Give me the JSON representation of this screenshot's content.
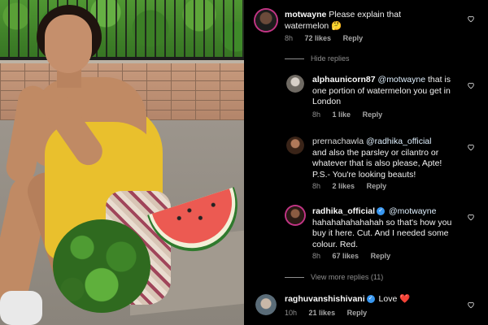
{
  "comments": [
    {
      "username": "motwayne",
      "text_lines": [
        "Please explain that",
        "watermelon 🤔"
      ],
      "time": "8h",
      "likes": "72 likes",
      "reply": "Reply"
    },
    {
      "username": "alphaunicorn87",
      "mention": "@motwayne",
      "text_lines": [
        "that is",
        "one portion of watermelon you get in",
        "London"
      ],
      "time": "8h",
      "likes": "1 like",
      "reply": "Reply"
    },
    {
      "username": "prernachawla",
      "mention": "@radhika_official",
      "text_lines": [
        "and also the parsley or cilantro or",
        "whatever that is also please, Apte!",
        "P.S.- You're looking beauts!"
      ],
      "time": "8h",
      "likes": "2 likes",
      "reply": "Reply"
    },
    {
      "username": "radhika_official",
      "mention": "@motwayne",
      "text_lines": [
        "hahahahahahahah so that's how you",
        "buy it here. Cut. And I needed some",
        "colour. Red."
      ],
      "time": "8h",
      "likes": "67 likes",
      "reply": "Reply"
    },
    {
      "username": "raghuvanshishivani",
      "text": "Love",
      "heart": "❤️",
      "time": "10h",
      "likes": "21 likes",
      "reply": "Reply"
    }
  ],
  "hide_replies": "Hide replies",
  "view_more_replies": "View more replies (11)",
  "colors": {
    "background": "#000000",
    "verified": "#3897f0",
    "muted": "#8e8e8e",
    "story_ring": "#c13584"
  },
  "icons": {
    "like": "heart-outline-icon",
    "verified": "verified-badge-icon"
  }
}
